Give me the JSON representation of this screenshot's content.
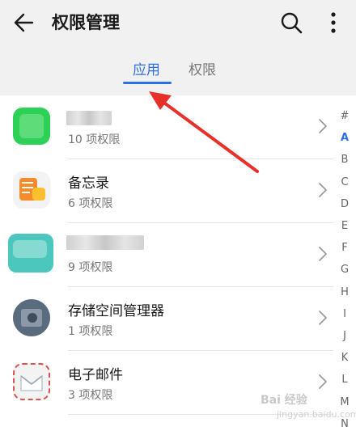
{
  "header": {
    "title": "权限管理",
    "back_icon": "arrow-left",
    "search_icon": "search",
    "more_icon": "more-vertical"
  },
  "tabs": [
    {
      "label": "应用",
      "active": true
    },
    {
      "label": "权限",
      "active": false
    }
  ],
  "apps": [
    {
      "name": "",
      "sub": "10 项权限",
      "icon": "blurred-green-app"
    },
    {
      "name": "备忘录",
      "sub": "6 项权限",
      "icon": "memo-icon"
    },
    {
      "name": "",
      "sub": "9 项权限",
      "icon": "blurred-teal-app"
    },
    {
      "name": "存储空间管理器",
      "sub": "1 项权限",
      "icon": "storage-manager-icon"
    },
    {
      "name": "电子邮件",
      "sub": "3 项权限",
      "icon": "email-icon"
    }
  ],
  "alphabet_index": [
    "#",
    "A",
    "B",
    "C",
    "D",
    "E",
    "F",
    "G",
    "H",
    "I",
    "J",
    "K",
    "L",
    "M",
    "N"
  ],
  "active_index": "A",
  "watermark": {
    "text": "Bai 经验",
    "sub": "jingyan.baidu.com"
  },
  "colors": {
    "accent": "#2f6fe4",
    "arrow": "#e8302a"
  }
}
